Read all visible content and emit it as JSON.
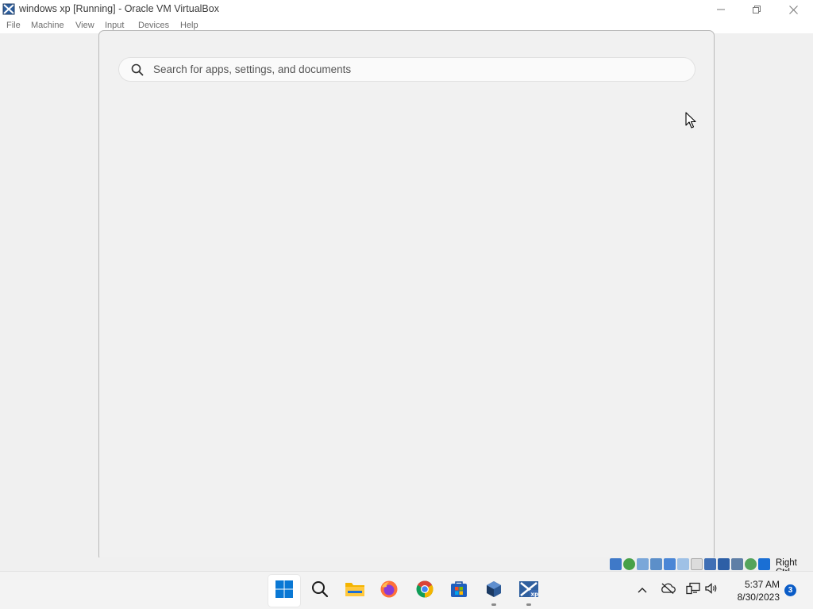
{
  "window": {
    "title": "windows xp [Running] - Oracle VM VirtualBox",
    "app_icon": "virtualbox-icon",
    "controls": [
      "minimize-icon",
      "restore-icon",
      "close-icon"
    ]
  },
  "menubar": {
    "items": [
      "File",
      "Machine",
      "View",
      "Input",
      "Devices",
      "Help"
    ]
  },
  "start_panel": {
    "search": {
      "placeholder": "Search for apps, settings, and documents",
      "icon": "search-icon"
    }
  },
  "statusbar": {
    "device_icons": [
      "hard-disk-icon",
      "optical-drive-icon",
      "audio-icon",
      "network-icon",
      "usb-icon",
      "shared-folders-icon",
      "display-icon",
      "video-capture-icon",
      "mouse-integration-icon",
      "keyboard-icon",
      "download-icon"
    ],
    "host_key": "Right Ctrl"
  },
  "taskbar": {
    "apps": [
      {
        "name": "start",
        "icon": "windows-start-icon"
      },
      {
        "name": "search",
        "icon": "search-icon"
      },
      {
        "name": "file-explorer",
        "icon": "folder-icon"
      },
      {
        "name": "firefox",
        "icon": "firefox-icon"
      },
      {
        "name": "chrome",
        "icon": "chrome-icon"
      },
      {
        "name": "microsoft-store",
        "icon": "store-icon"
      },
      {
        "name": "virtualbox",
        "icon": "virtualbox-cube-icon"
      },
      {
        "name": "windows-xp-vm",
        "icon": "virtualbox-vm-icon"
      }
    ],
    "tray": {
      "icons": [
        "chevron-up-icon",
        "onedrive-offline-icon",
        "network-icon",
        "volume-icon"
      ],
      "time": "5:37 AM",
      "date": "8/30/2023",
      "notification_count": "3"
    }
  },
  "colors": {
    "accent": "#0a5cc7",
    "background": "#f0f0f0",
    "windows_blue": "#0078d4"
  }
}
